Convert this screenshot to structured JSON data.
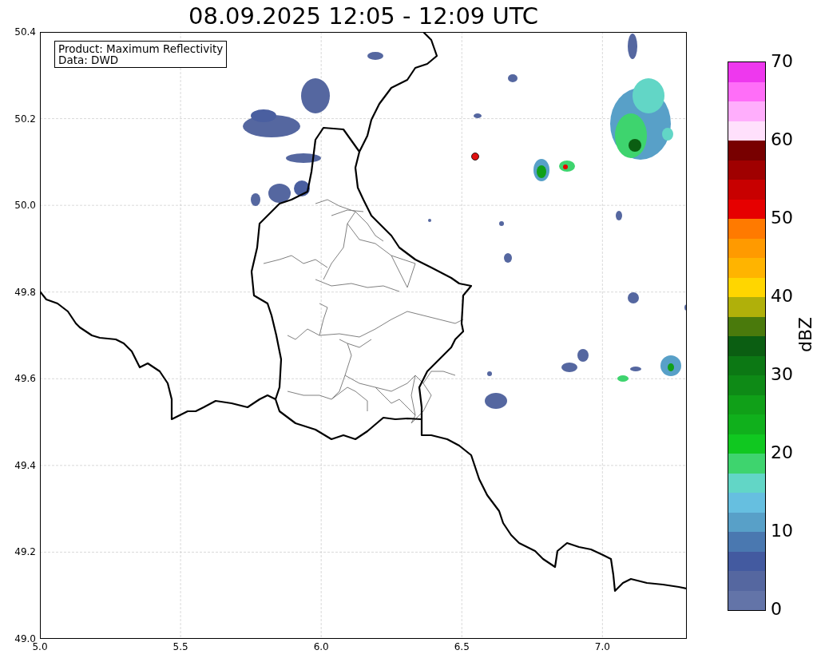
{
  "title": "08.09.2025 12:05 - 12:09 UTC",
  "info_box": {
    "lines": [
      "Product: Maximum Reflectivity",
      "Data: DWD"
    ]
  },
  "x_axis": {
    "ticks": [
      "5.0",
      "5.5",
      "6.0",
      "6.5",
      "7.0"
    ]
  },
  "y_axis": {
    "ticks": [
      "50.4",
      "50.2",
      "50.0",
      "49.8",
      "49.6",
      "49.4",
      "49.2",
      "49.0"
    ]
  },
  "colorbar": {
    "label": "dBZ",
    "ticks": [
      "70",
      "60",
      "50",
      "40",
      "30",
      "20",
      "10",
      "0"
    ],
    "segments": [
      {
        "color": "#6374a8"
      },
      {
        "color": "#5567a0"
      },
      {
        "color": "#435aa0"
      },
      {
        "color": "#4a78b0"
      },
      {
        "color": "#58a0c8"
      },
      {
        "color": "#66bfe0"
      },
      {
        "color": "#62d6c6"
      },
      {
        "color": "#3ed46e"
      },
      {
        "color": "#10c820"
      },
      {
        "color": "#10b01c"
      },
      {
        "color": "#10a018"
      },
      {
        "color": "#0e8a16"
      },
      {
        "color": "#0c7814"
      },
      {
        "color": "#0b5e12"
      },
      {
        "color": "#4a7a0c"
      },
      {
        "color": "#b0b00a"
      },
      {
        "color": "#ffd600"
      },
      {
        "color": "#ffb400"
      },
      {
        "color": "#ff9a00"
      },
      {
        "color": "#ff7a00"
      },
      {
        "color": "#e60000"
      },
      {
        "color": "#c80000"
      },
      {
        "color": "#a00000"
      },
      {
        "color": "#780000"
      },
      {
        "color": "#ffe0fc"
      },
      {
        "color": "#ffaefc"
      },
      {
        "color": "#ff6ef8"
      },
      {
        "color": "#ee38ee"
      }
    ]
  }
}
